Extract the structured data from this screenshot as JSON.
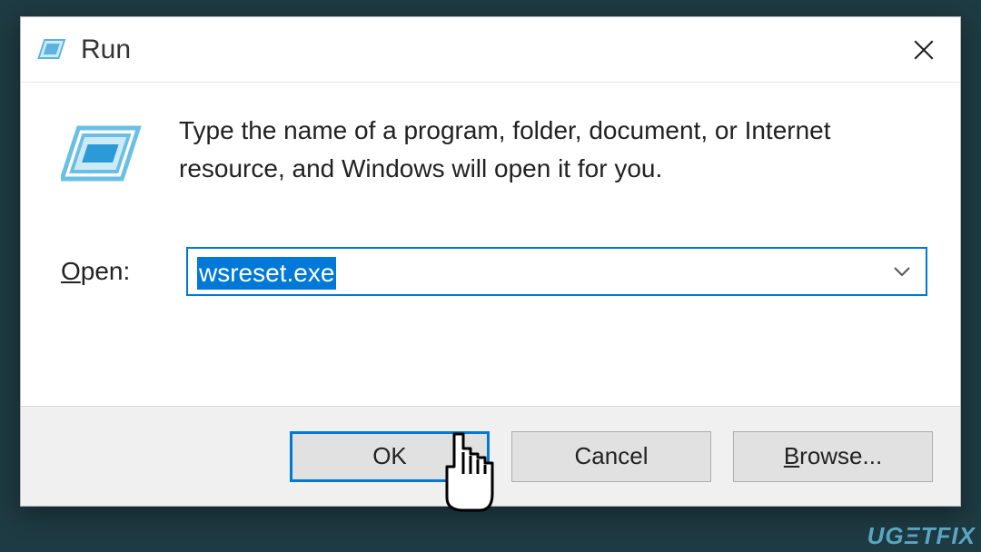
{
  "dialog": {
    "title": "Run",
    "description": "Type the name of a program, folder, document, or Internet resource, and Windows will open it for you.",
    "open_label_pre": "O",
    "open_label_post": "pen:",
    "input_value": "wsreset.exe",
    "buttons": {
      "ok": "OK",
      "cancel": "Cancel",
      "browse_pre": "B",
      "browse_post": "rowse..."
    }
  },
  "watermark": "UGΞTFIX"
}
